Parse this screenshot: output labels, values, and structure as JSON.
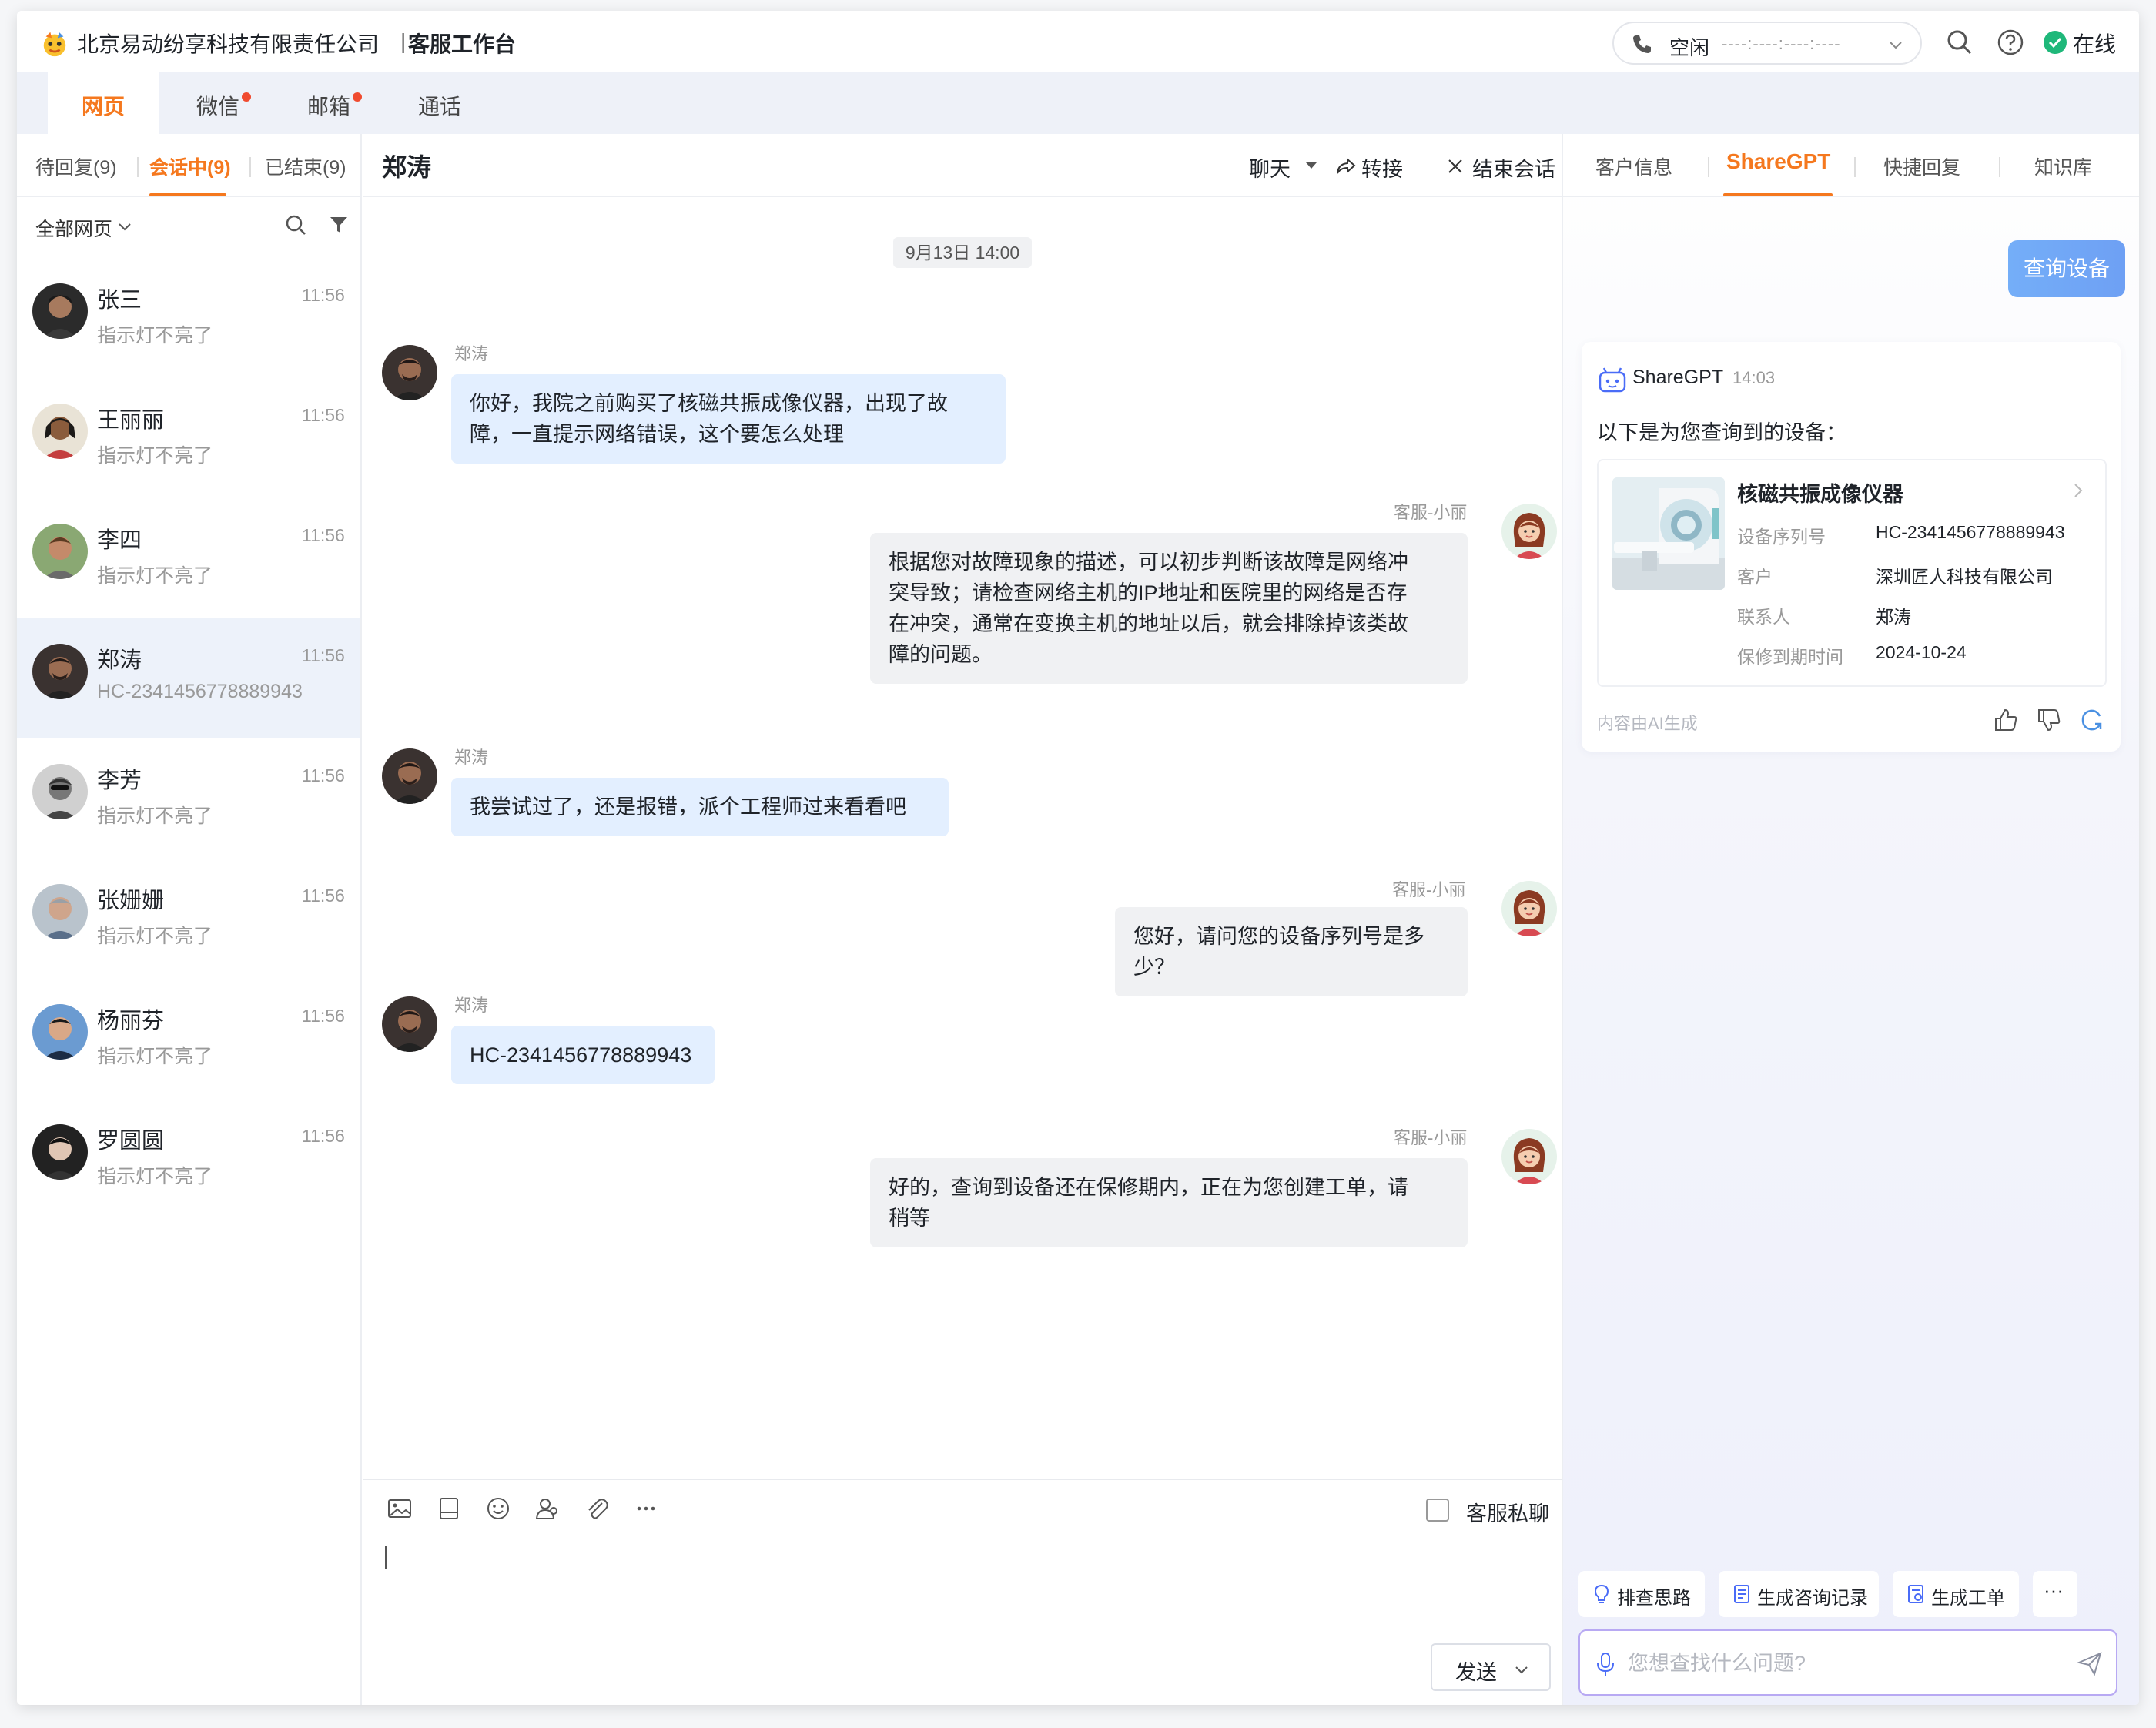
{
  "colors": {
    "accent": "#f5781e",
    "online": "#1fb87a",
    "badge": "#f04b2f",
    "incoming_bubble": "#e3efff",
    "outgoing_bubble": "#f0f1f3",
    "query_blue": "#74aef8"
  },
  "header": {
    "company": "北京易动纷享科技有限责任公司",
    "separator": "|",
    "workbench": "客服工作台",
    "call_status": "空闲",
    "call_timer": "----:----:----:----",
    "online_label": "在线"
  },
  "channels": [
    {
      "label": "网页",
      "active": true,
      "badge": false
    },
    {
      "label": "微信",
      "active": false,
      "badge": true
    },
    {
      "label": "邮箱",
      "active": false,
      "badge": true
    },
    {
      "label": "通话",
      "active": false,
      "badge": false
    }
  ],
  "left": {
    "tabs": [
      "待回复(9)",
      "会话中(9)",
      "已结束(9)"
    ],
    "filter_label": "全部网页",
    "contacts": [
      {
        "name": "张三",
        "time": "11:56",
        "message": "指示灯不亮了",
        "avatar": "avatar-1"
      },
      {
        "name": "王丽丽",
        "time": "11:56",
        "message": "指示灯不亮了",
        "avatar": "avatar-2"
      },
      {
        "name": "李四",
        "time": "11:56",
        "message": "指示灯不亮了",
        "avatar": "avatar-3"
      },
      {
        "name": "郑涛",
        "time": "11:56",
        "message": "HC-2341456778889943",
        "avatar": "avatar-4"
      },
      {
        "name": "李芳",
        "time": "11:56",
        "message": "指示灯不亮了",
        "avatar": "avatar-5"
      },
      {
        "name": "张姗姗",
        "time": "11:56",
        "message": "指示灯不亮了",
        "avatar": "avatar-6"
      },
      {
        "name": "杨丽芬",
        "time": "11:56",
        "message": "指示灯不亮了",
        "avatar": "avatar-7"
      },
      {
        "name": "罗圆圆",
        "time": "11:56",
        "message": "指示灯不亮了",
        "avatar": "avatar-8"
      }
    ]
  },
  "chat": {
    "title": "郑涛",
    "mode_label": "聊天",
    "transfer_label": "转接",
    "end_label": "结束会话",
    "date": "9月13日 14:00",
    "messages": [
      {
        "sender": "郑涛",
        "lines": [
          "你好，我院之前购买了核磁共振成像仪器，出现了故",
          "障，一直提示网络错误，这个要怎么处理"
        ]
      },
      {
        "sender": "客服-小丽",
        "lines": [
          "根据您对故障现象的描述，可以初步判断该故障是网络冲",
          "突导致；请检查网络主机的IP地址和医院里的网络是否存",
          "在冲突，通常在变换主机的地址以后，就会排除掉该类故",
          "障的问题。"
        ]
      },
      {
        "sender": "郑涛",
        "lines": [
          "我尝试过了，还是报错，派个工程师过来看看吧"
        ]
      },
      {
        "sender": "客服-小丽",
        "lines": [
          "您好，请问您的设备序列号是多少？"
        ]
      },
      {
        "sender": "郑涛",
        "lines": [
          "HC-2341456778889943"
        ]
      },
      {
        "sender": "客服-小丽",
        "lines": [
          "好的，查询到设备还在保修期内，正在为您创建工单，请",
          "稍等"
        ]
      }
    ],
    "private_label": "客服私聊",
    "send_label": "发送"
  },
  "right": {
    "tabs": [
      "客户信息",
      "ShareGPT",
      "快捷回复",
      "知识库"
    ],
    "query": "查询设备",
    "ai_name": "ShareGPT",
    "ai_time": "14:03",
    "intro": "以下是为您查询到的设备：",
    "device": {
      "title": "核磁共振成像仪器",
      "fields": [
        {
          "key": "设备序列号",
          "value": "HC-2341456778889943"
        },
        {
          "key": "客户",
          "value": "深圳匠人科技有限公司"
        },
        {
          "key": "联系人",
          "value": "郑涛"
        },
        {
          "key": "保修到期时间",
          "value": "2024-10-24"
        }
      ]
    },
    "footnote": "内容由AI生成",
    "chips": [
      "排查思路",
      "生成咨询记录",
      "生成工单"
    ],
    "more": "···",
    "ask_placeholder": "您想查找什么问题?"
  }
}
